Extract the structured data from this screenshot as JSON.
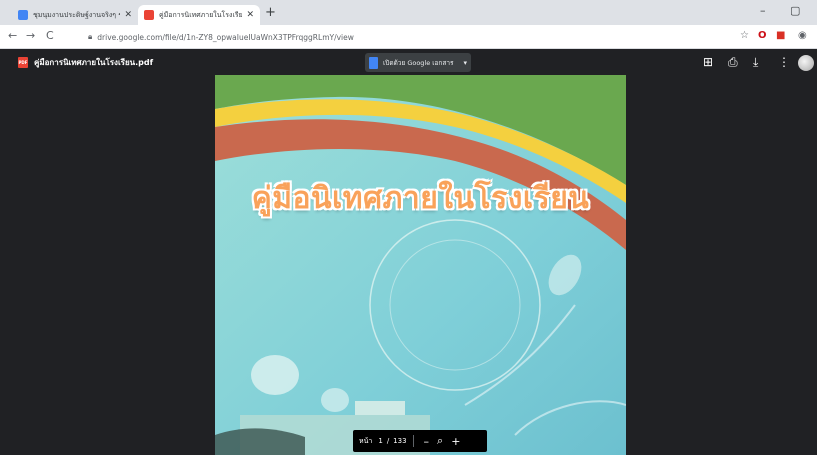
{
  "browser": {
    "tabs": [
      {
        "title": "ชุมนุมงานประดิษฐ์งานจริงๆ ชุดนักเรียน การใช้ข้อมูลหลักสูตร",
        "favicon_color": "#4285f4",
        "active": false
      },
      {
        "title": "คู่มือการนิเทศภายในโรงเรียน.pdf - Google Drive",
        "favicon_color": "#ea4335",
        "active": true
      }
    ],
    "new_tab": "+",
    "minimize": "–",
    "maximize": "▢",
    "url": "drive.google.com/file/d/1n-ZY8_opwaIueIUaWnX3TPFrqggRLmY/view"
  },
  "viewer": {
    "file_name": "คู่มือการนิเทศภายในโรงเรียน.pdf",
    "file_badge": "PDF",
    "open_with_label": "เปิดด้วย Google เอกสาร",
    "icons": [
      "add-comment-icon",
      "print-icon",
      "download-icon",
      "more-vert-icon"
    ]
  },
  "document": {
    "title": "คู่มือนิเทศภายในโรงเรียน",
    "page_label": "หน้า",
    "current_page": "1",
    "separator": "/",
    "total_pages": "133",
    "zoom_out": "–",
    "zoom_in": "+"
  },
  "colors": {
    "viewer_bg": "#202124",
    "cover_green": "#6aa84f",
    "cover_yellow": "#f4d03f",
    "cover_red": "#c0654a",
    "cover_teal": "#8fd3d6",
    "title_orange": "#f9a25a"
  }
}
